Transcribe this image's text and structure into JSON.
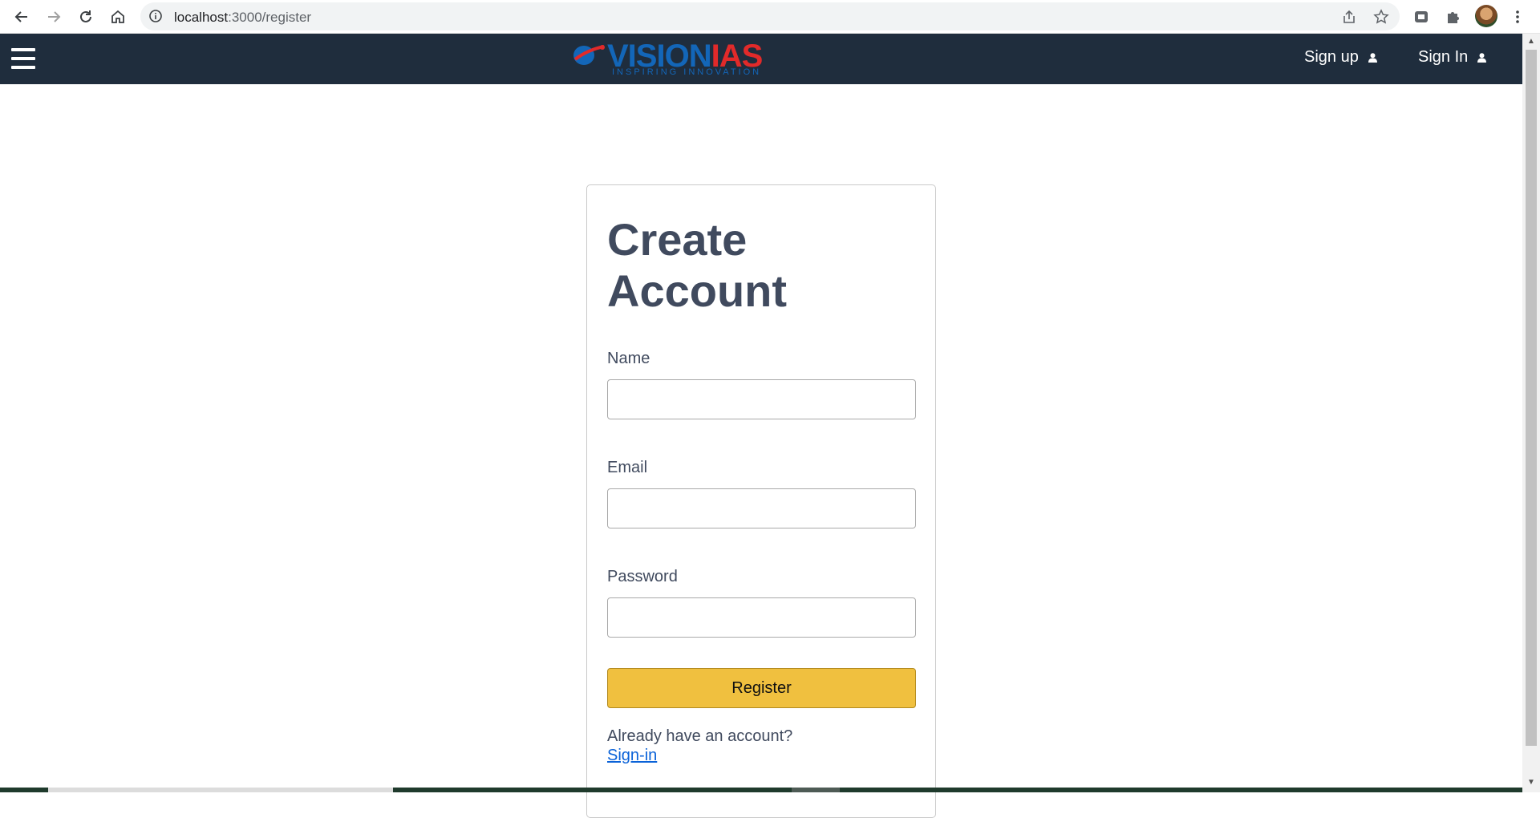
{
  "browser": {
    "url_host": "localhost",
    "url_path": ":3000/register",
    "icons": {
      "back": "arrow-left-icon",
      "forward": "arrow-right-icon",
      "reload": "reload-icon",
      "home": "home-icon",
      "info": "info-icon",
      "share": "share-icon",
      "bookmark": "star-icon",
      "extension1": "extension-app-icon",
      "extensions": "puzzle-icon",
      "profile": "avatar",
      "menu": "kebab-menu-icon"
    }
  },
  "navbar": {
    "background": "#1f2d3d",
    "logo_vision": "VISION",
    "logo_ias": "IAS",
    "logo_tagline": "INSPIRING INNOVATION",
    "signup_label": "Sign up",
    "signin_label": "Sign In"
  },
  "form": {
    "title_line1": "Create",
    "title_line2": "Account",
    "name_label": "Name",
    "name_value": "",
    "email_label": "Email",
    "email_value": "",
    "password_label": "Password",
    "password_value": "",
    "register_label": "Register",
    "register_color": "#f0c03f",
    "already_text": "Already have an account?",
    "signin_link": "Sign-in"
  }
}
